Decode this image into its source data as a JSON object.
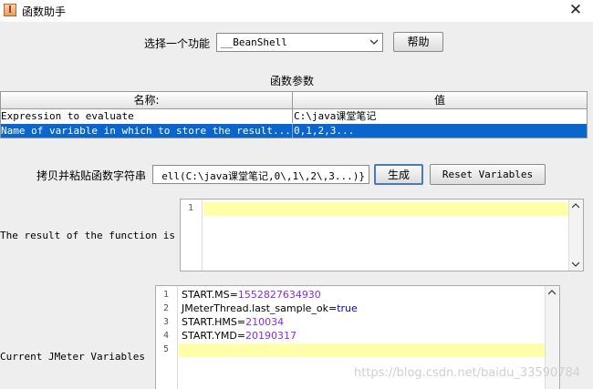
{
  "window": {
    "title": "函数助手"
  },
  "function_select": {
    "label": "选择一个功能",
    "value": "__BeanShell",
    "help_button": "帮助"
  },
  "params": {
    "section_title": "函数参数",
    "columns": [
      "名称:",
      "值"
    ],
    "rows": [
      {
        "name": "Expression to evaluate",
        "value": "C:\\java课堂笔记"
      },
      {
        "name": "Name of variable in which to store the result...",
        "value": "0,1,2,3..."
      }
    ]
  },
  "copy_paste": {
    "label": "拷贝并粘贴函数字符串",
    "value": "ell(C:\\java课堂笔记,0\\,1\\,2\\,3...)}",
    "generate_button": "生成",
    "reset_button": "Reset Variables"
  },
  "result": {
    "label": "The result of the function is",
    "line_numbers": [
      "1"
    ]
  },
  "variables": {
    "label": "Current JMeter Variables",
    "line_numbers": [
      "1",
      "2",
      "3",
      "4",
      "5"
    ],
    "lines": [
      {
        "key": "START.MS=",
        "val": "1552827634930"
      },
      {
        "key": "JMeterThread.last_sample_ok=",
        "val": "true"
      },
      {
        "key": "START.HMS=",
        "val": "210034"
      },
      {
        "key": "START.YMD=",
        "val": "20190317"
      }
    ]
  },
  "watermark": "https://blog.csdn.net/baidu_33590784",
  "colors": {
    "selection": "#0a66cc",
    "current_line": "#ffffaa",
    "value_purple": "#8a2be2"
  },
  "icons": [
    "app-icon",
    "close-icon",
    "chevron-down-icon",
    "scroll-up-icon",
    "scroll-down-icon"
  ]
}
